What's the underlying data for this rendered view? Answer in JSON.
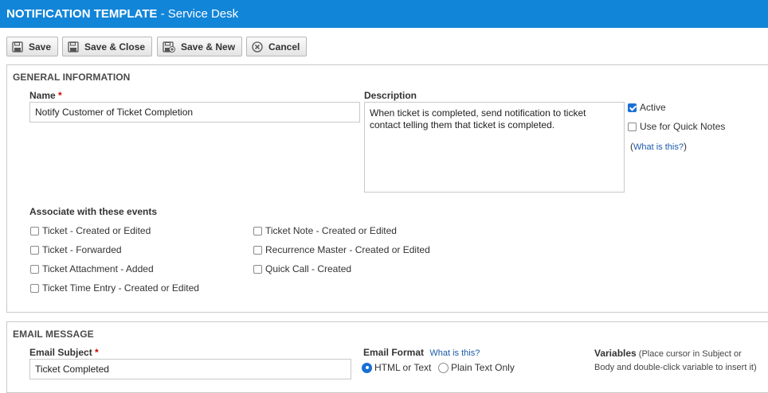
{
  "title": {
    "main": "NOTIFICATION TEMPLATE",
    "sep": " - ",
    "sub": "Service Desk"
  },
  "toolbar": {
    "save": "Save",
    "save_close": "Save & Close",
    "save_new": "Save & New",
    "cancel": "Cancel"
  },
  "general": {
    "heading": "GENERAL INFORMATION",
    "name_label": "Name",
    "required_mark": "*",
    "name_value": "Notify Customer of Ticket Completion",
    "description_label": "Description",
    "description_value": "When ticket is completed, send notification to ticket contact telling them that ticket is completed.",
    "active_label": "Active",
    "active_checked": true,
    "quick_notes_label": "Use for Quick Notes",
    "quick_notes_checked": false,
    "paren_open": "(",
    "paren_close": ")",
    "what_is_this": "What is this?",
    "events_label": "Associate with these events",
    "events_left": [
      "Ticket - Created or Edited",
      "Ticket - Forwarded",
      "Ticket Attachment - Added",
      "Ticket Time Entry - Created or Edited"
    ],
    "events_right": [
      "Ticket Note - Created or Edited",
      "Recurrence Master - Created or Edited",
      "Quick Call - Created"
    ]
  },
  "email": {
    "heading": "EMAIL MESSAGE",
    "subject_label": "Email Subject",
    "required_mark": "*",
    "subject_value": "Ticket Completed",
    "format_label": "Email Format",
    "format_help": "What is this?",
    "format_options": [
      "HTML or Text",
      "Plain Text Only"
    ],
    "format_selected": "HTML or Text",
    "variables_label": "Variables",
    "variables_hint": "(Place cursor in Subject or Body and double-click variable to insert it)"
  },
  "colors": {
    "title_bar": "#1185d8",
    "link": "#1a5aa8",
    "required": "#d00000",
    "checked": "#1a6fd6"
  }
}
